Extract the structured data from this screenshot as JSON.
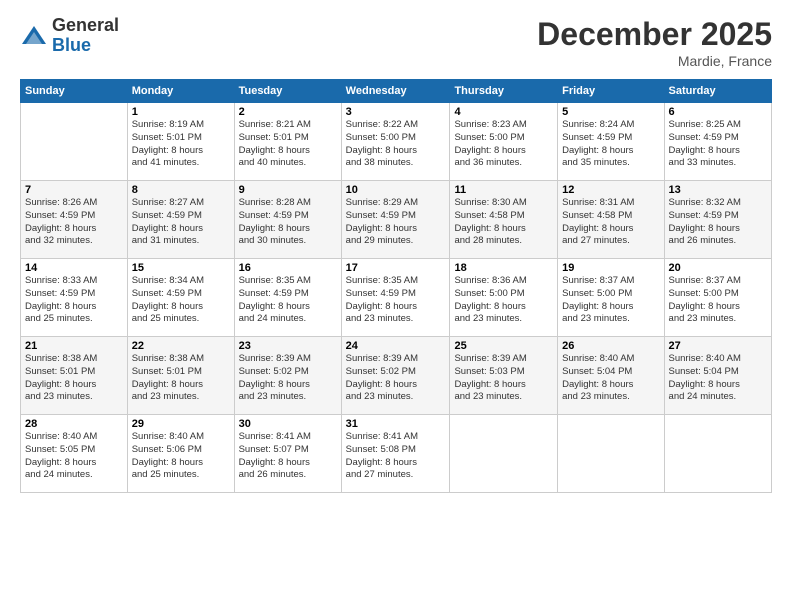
{
  "header": {
    "logo": {
      "general": "General",
      "blue": "Blue"
    },
    "title": "December 2025",
    "subtitle": "Mardie, France"
  },
  "calendar": {
    "days_of_week": [
      "Sunday",
      "Monday",
      "Tuesday",
      "Wednesday",
      "Thursday",
      "Friday",
      "Saturday"
    ],
    "weeks": [
      [
        {
          "day": "",
          "info": ""
        },
        {
          "day": "1",
          "info": "Sunrise: 8:19 AM\nSunset: 5:01 PM\nDaylight: 8 hours\nand 41 minutes."
        },
        {
          "day": "2",
          "info": "Sunrise: 8:21 AM\nSunset: 5:01 PM\nDaylight: 8 hours\nand 40 minutes."
        },
        {
          "day": "3",
          "info": "Sunrise: 8:22 AM\nSunset: 5:00 PM\nDaylight: 8 hours\nand 38 minutes."
        },
        {
          "day": "4",
          "info": "Sunrise: 8:23 AM\nSunset: 5:00 PM\nDaylight: 8 hours\nand 36 minutes."
        },
        {
          "day": "5",
          "info": "Sunrise: 8:24 AM\nSunset: 4:59 PM\nDaylight: 8 hours\nand 35 minutes."
        },
        {
          "day": "6",
          "info": "Sunrise: 8:25 AM\nSunset: 4:59 PM\nDaylight: 8 hours\nand 33 minutes."
        }
      ],
      [
        {
          "day": "7",
          "info": "Sunrise: 8:26 AM\nSunset: 4:59 PM\nDaylight: 8 hours\nand 32 minutes."
        },
        {
          "day": "8",
          "info": "Sunrise: 8:27 AM\nSunset: 4:59 PM\nDaylight: 8 hours\nand 31 minutes."
        },
        {
          "day": "9",
          "info": "Sunrise: 8:28 AM\nSunset: 4:59 PM\nDaylight: 8 hours\nand 30 minutes."
        },
        {
          "day": "10",
          "info": "Sunrise: 8:29 AM\nSunset: 4:59 PM\nDaylight: 8 hours\nand 29 minutes."
        },
        {
          "day": "11",
          "info": "Sunrise: 8:30 AM\nSunset: 4:58 PM\nDaylight: 8 hours\nand 28 minutes."
        },
        {
          "day": "12",
          "info": "Sunrise: 8:31 AM\nSunset: 4:58 PM\nDaylight: 8 hours\nand 27 minutes."
        },
        {
          "day": "13",
          "info": "Sunrise: 8:32 AM\nSunset: 4:59 PM\nDaylight: 8 hours\nand 26 minutes."
        }
      ],
      [
        {
          "day": "14",
          "info": "Sunrise: 8:33 AM\nSunset: 4:59 PM\nDaylight: 8 hours\nand 25 minutes."
        },
        {
          "day": "15",
          "info": "Sunrise: 8:34 AM\nSunset: 4:59 PM\nDaylight: 8 hours\nand 25 minutes."
        },
        {
          "day": "16",
          "info": "Sunrise: 8:35 AM\nSunset: 4:59 PM\nDaylight: 8 hours\nand 24 minutes."
        },
        {
          "day": "17",
          "info": "Sunrise: 8:35 AM\nSunset: 4:59 PM\nDaylight: 8 hours\nand 23 minutes."
        },
        {
          "day": "18",
          "info": "Sunrise: 8:36 AM\nSunset: 5:00 PM\nDaylight: 8 hours\nand 23 minutes."
        },
        {
          "day": "19",
          "info": "Sunrise: 8:37 AM\nSunset: 5:00 PM\nDaylight: 8 hours\nand 23 minutes."
        },
        {
          "day": "20",
          "info": "Sunrise: 8:37 AM\nSunset: 5:00 PM\nDaylight: 8 hours\nand 23 minutes."
        }
      ],
      [
        {
          "day": "21",
          "info": "Sunrise: 8:38 AM\nSunset: 5:01 PM\nDaylight: 8 hours\nand 23 minutes."
        },
        {
          "day": "22",
          "info": "Sunrise: 8:38 AM\nSunset: 5:01 PM\nDaylight: 8 hours\nand 23 minutes."
        },
        {
          "day": "23",
          "info": "Sunrise: 8:39 AM\nSunset: 5:02 PM\nDaylight: 8 hours\nand 23 minutes."
        },
        {
          "day": "24",
          "info": "Sunrise: 8:39 AM\nSunset: 5:02 PM\nDaylight: 8 hours\nand 23 minutes."
        },
        {
          "day": "25",
          "info": "Sunrise: 8:39 AM\nSunset: 5:03 PM\nDaylight: 8 hours\nand 23 minutes."
        },
        {
          "day": "26",
          "info": "Sunrise: 8:40 AM\nSunset: 5:04 PM\nDaylight: 8 hours\nand 23 minutes."
        },
        {
          "day": "27",
          "info": "Sunrise: 8:40 AM\nSunset: 5:04 PM\nDaylight: 8 hours\nand 24 minutes."
        }
      ],
      [
        {
          "day": "28",
          "info": "Sunrise: 8:40 AM\nSunset: 5:05 PM\nDaylight: 8 hours\nand 24 minutes."
        },
        {
          "day": "29",
          "info": "Sunrise: 8:40 AM\nSunset: 5:06 PM\nDaylight: 8 hours\nand 25 minutes."
        },
        {
          "day": "30",
          "info": "Sunrise: 8:41 AM\nSunset: 5:07 PM\nDaylight: 8 hours\nand 26 minutes."
        },
        {
          "day": "31",
          "info": "Sunrise: 8:41 AM\nSunset: 5:08 PM\nDaylight: 8 hours\nand 27 minutes."
        },
        {
          "day": "",
          "info": ""
        },
        {
          "day": "",
          "info": ""
        },
        {
          "day": "",
          "info": ""
        }
      ]
    ]
  }
}
